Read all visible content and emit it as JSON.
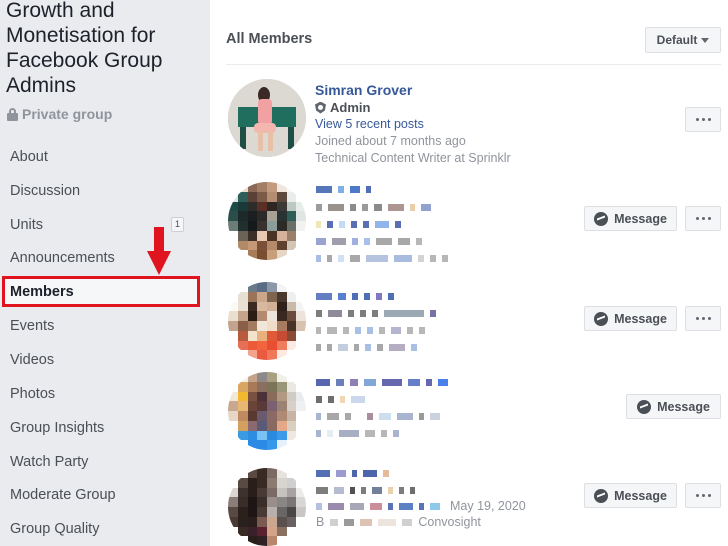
{
  "sidebar": {
    "group_title": "Growth and Monetisation for Facebook Group Admins",
    "privacy_label": "Private group",
    "privacy_icon": "lock-icon",
    "items": [
      {
        "label": "About",
        "active": false
      },
      {
        "label": "Discussion",
        "active": false
      },
      {
        "label": "Units",
        "active": false,
        "badge": "1"
      },
      {
        "label": "Announcements",
        "active": false
      },
      {
        "label": "Members",
        "active": true
      },
      {
        "label": "Events",
        "active": false
      },
      {
        "label": "Videos",
        "active": false
      },
      {
        "label": "Photos",
        "active": false
      },
      {
        "label": "Group Insights",
        "active": false
      },
      {
        "label": "Watch Party",
        "active": false
      },
      {
        "label": "Moderate Group",
        "active": false
      },
      {
        "label": "Group Quality",
        "active": false
      }
    ],
    "annotation": {
      "type": "red-arrow-and-box",
      "target": "Members",
      "color": "#e0141e"
    }
  },
  "main": {
    "title": "All Members",
    "sort": {
      "selected": "Default",
      "icon": "caret-down-icon"
    },
    "members": [
      {
        "name": "Simran Grover",
        "role": "Admin",
        "role_icon": "shield-icon",
        "posts_link": "View 5 recent posts",
        "joined": "Joined about 7 months ago",
        "bio": "Technical Content Writer at Sprinklr",
        "show_message": false,
        "show_more": true
      },
      {
        "name": "[blurred]",
        "blurred": true,
        "show_message": true,
        "show_more": true,
        "message_label": "Message"
      },
      {
        "name": "[blurred]",
        "blurred": true,
        "show_message": true,
        "show_more": true,
        "message_label": "Message"
      },
      {
        "name": "[blurred]",
        "blurred": true,
        "show_message": true,
        "show_more": false,
        "message_label": "Message"
      },
      {
        "name": "[blurred]",
        "blurred": true,
        "visible_fragment_date": "May 19, 2020",
        "visible_fragment_bio_prefix": "B",
        "visible_fragment_bio_suffix": "Convosight",
        "show_message": true,
        "show_more": true,
        "message_label": "Message"
      }
    ],
    "message_label": "Message",
    "message_icon": "messenger-icon",
    "more_icon": "more-options-icon"
  },
  "colors": {
    "sidebar_bg": "#e9ebee",
    "link_blue": "#365899",
    "annotation_red": "#e0141e",
    "muted_text": "#90949c"
  }
}
